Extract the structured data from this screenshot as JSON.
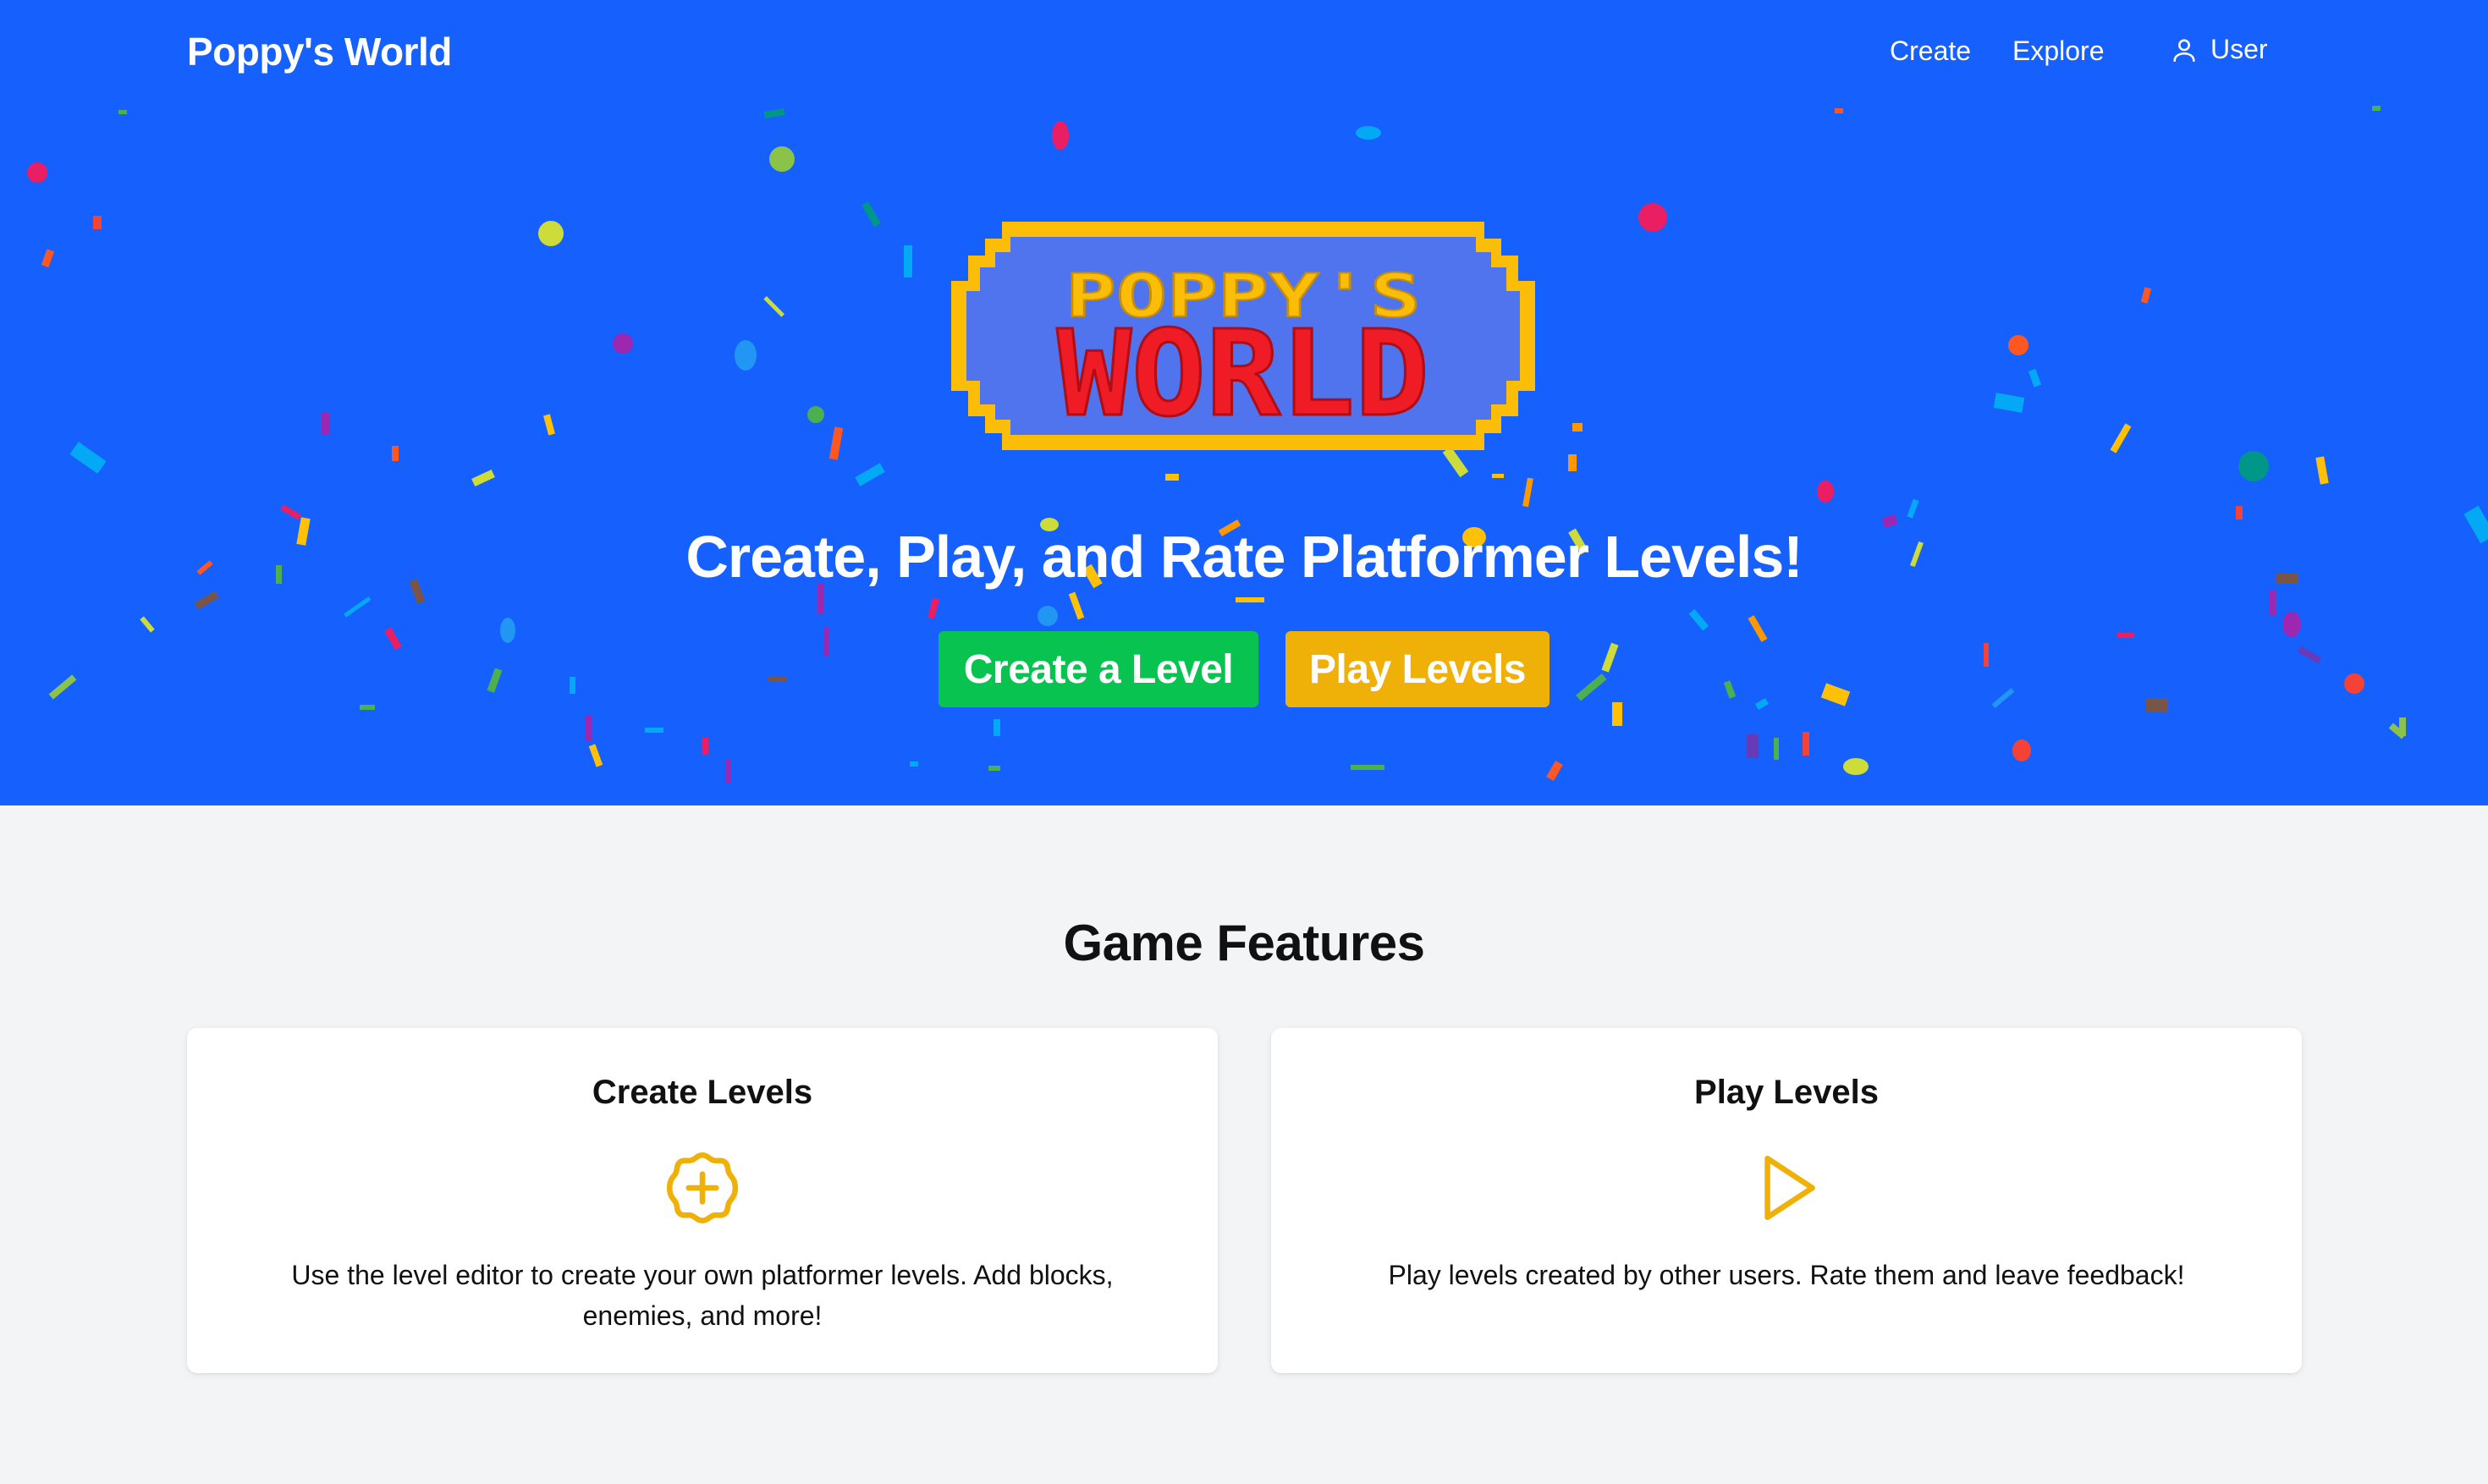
{
  "nav": {
    "brand": "Poppy's World",
    "links": [
      {
        "label": "Create"
      },
      {
        "label": "Explore"
      }
    ],
    "user_label": "User"
  },
  "hero": {
    "logo_line1": "POPPY'S",
    "logo_line2": "WORLD",
    "tagline": "Create, Play, and Rate Platformer Levels!",
    "create_button": "Create a Level",
    "play_button": "Play Levels"
  },
  "features": {
    "title": "Game Features",
    "cards": [
      {
        "title": "Create Levels",
        "icon": "plus-badge-icon",
        "description": "Use the level editor to create your own platformer levels. Add blocks, enemies, and more!"
      },
      {
        "title": "Play Levels",
        "icon": "play-icon",
        "description": "Play levels created by other users. Rate them and leave feedback!"
      }
    ]
  },
  "colors": {
    "hero_bg": "#1660fe",
    "page_bg": "#f3f4f6",
    "create_button": "#08c350",
    "play_button": "#efb008",
    "icon_accent": "#efb008",
    "logo_border": "#fbbd08",
    "logo_fill": "#5074ee",
    "logo_red": "#ef1c25"
  }
}
